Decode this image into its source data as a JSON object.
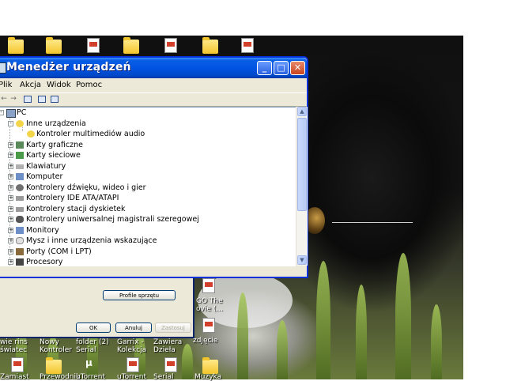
{
  "window": {
    "title": "Menedżer urządzeń",
    "menu": [
      "Plik",
      "Akcja",
      "Widok",
      "Pomoc"
    ]
  },
  "tree": [
    {
      "label": "PC",
      "expander": "-",
      "icon": "computer-icon"
    },
    {
      "label": "Inne urządzenia",
      "expander": "-",
      "icon": "warning-icon"
    },
    {
      "label": "Kontroler multimediów audio",
      "expander": "",
      "icon": "warning-device-icon"
    },
    {
      "label": "Karty graficzne",
      "expander": "+",
      "icon": "display-adapter-icon"
    },
    {
      "label": "Karty sieciowe",
      "expander": "+",
      "icon": "network-adapter-icon"
    },
    {
      "label": "Klawiatury",
      "expander": "+",
      "icon": "keyboard-icon"
    },
    {
      "label": "Komputer",
      "expander": "+",
      "icon": "computer-icon"
    },
    {
      "label": "Kontrolery dźwięku, wideo i gier",
      "expander": "+",
      "icon": "sound-icon"
    },
    {
      "label": "Kontrolery IDE ATA/ATAPI",
      "expander": "+",
      "icon": "ide-controller-icon"
    },
    {
      "label": "Kontrolery stacji dyskietek",
      "expander": "+",
      "icon": "floppy-controller-icon"
    },
    {
      "label": "Kontrolery uniwersalnej magistrali szeregowej",
      "expander": "+",
      "icon": "usb-icon"
    },
    {
      "label": "Monitory",
      "expander": "+",
      "icon": "monitor-icon"
    },
    {
      "label": "Mysz i inne urządzenia wskazujące",
      "expander": "+",
      "icon": "mouse-icon"
    },
    {
      "label": "Porty (COM i LPT)",
      "expander": "+",
      "icon": "port-icon"
    },
    {
      "label": "Procesory",
      "expander": "+",
      "icon": "processor-icon"
    }
  ],
  "back_dialog": {
    "button_profiles": "Profile sprzętu",
    "ok": "OK",
    "cancel": "Anuluj",
    "apply": "Zastosuj"
  },
  "desktop": {
    "labels": [
      "GO The",
      "ovie (...",
      "zdjęcie",
      "wie rins",
      "Nowy",
      "folder (2)",
      "Garrix -",
      "Zawiera",
      "światec",
      "Kontroler",
      "Serial",
      "Kolekcja",
      "Dzieła",
      "Zamiast",
      "Przewodnik",
      "uTorrent",
      "uTorrent",
      "Serial",
      "Muzyka",
      "Zdjęcie"
    ]
  }
}
